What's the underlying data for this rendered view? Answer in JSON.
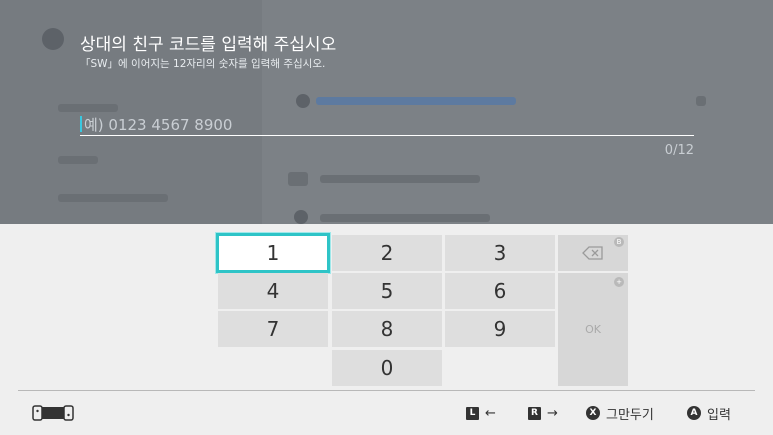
{
  "dialog": {
    "title": "상대의 친구 코드를 입력해 주십시오",
    "subtitle": "「SW」에 이어지는 12자리의 숫자를 입력해 주십시오.",
    "placeholder": "예) 0123 4567 8900",
    "counter": "0/12"
  },
  "keypad": {
    "keys": [
      "1",
      "2",
      "3",
      "4",
      "5",
      "6",
      "7",
      "8",
      "9",
      "0"
    ],
    "selected_key": "1",
    "backspace_badge": "B",
    "plus_badge": "+",
    "ok_label": "OK"
  },
  "footer": {
    "l_button": "L",
    "left_arrow": "←",
    "r_button": "R",
    "right_arrow": "→",
    "x_button": "X",
    "cancel_label": "그만두기",
    "a_button": "A",
    "confirm_label": "입력"
  },
  "colors": {
    "accent": "#2ec4c7",
    "overlay": "#7c8186",
    "keypad_bg": "#efefef",
    "key_bg": "#dedede"
  }
}
